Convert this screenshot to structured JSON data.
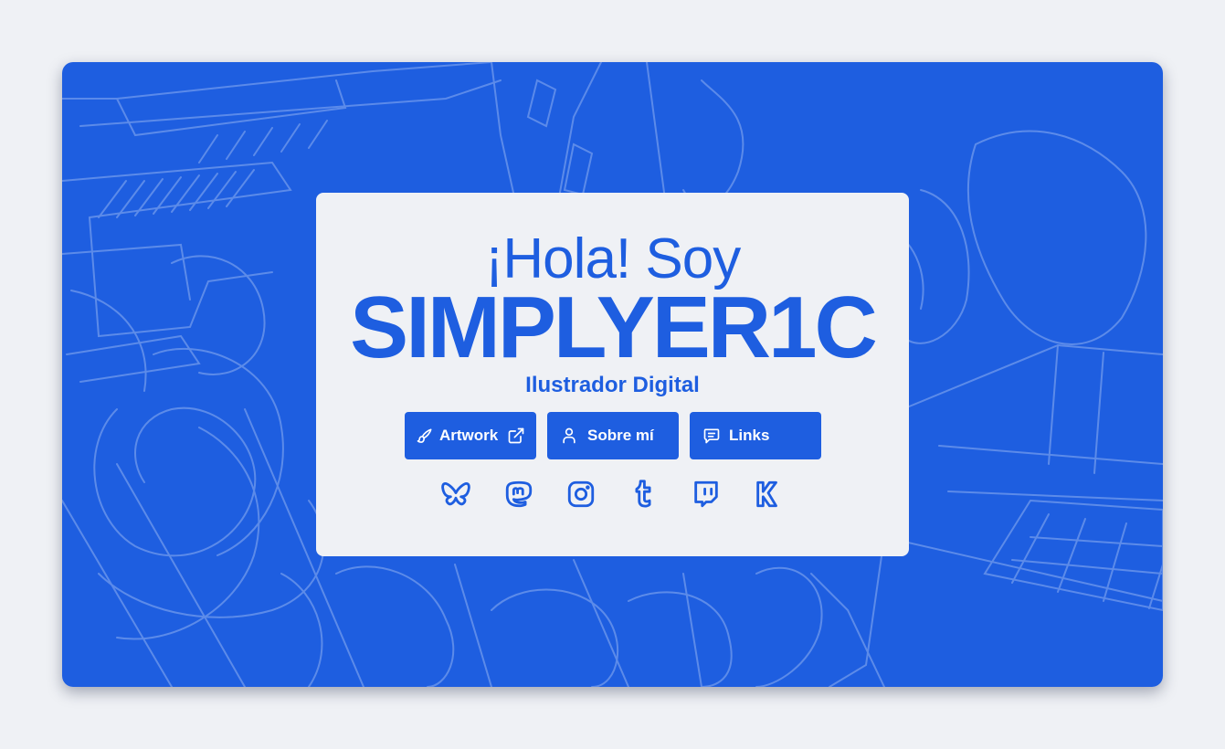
{
  "hero": {
    "greeting": "¡Hola! Soy",
    "name": "SIMPLYER1C",
    "subtitle": "Ilustrador Digital"
  },
  "buttons": {
    "artwork": {
      "label": "Artwork",
      "icon": "brush-icon",
      "external_icon": "external-link-icon"
    },
    "about": {
      "label": "Sobre mí",
      "icon": "user-icon"
    },
    "links": {
      "label": "Links",
      "icon": "message-icon"
    }
  },
  "social": [
    {
      "icon": "bluesky-icon"
    },
    {
      "icon": "mastodon-icon"
    },
    {
      "icon": "instagram-icon"
    },
    {
      "icon": "tumblr-icon"
    },
    {
      "icon": "twitch-icon"
    },
    {
      "icon": "kofi-icon"
    }
  ],
  "colors": {
    "accent": "#1e5ee0",
    "page_background": "#eff1f5",
    "card_background": "#eff1f5",
    "button_text": "#ffffff"
  }
}
